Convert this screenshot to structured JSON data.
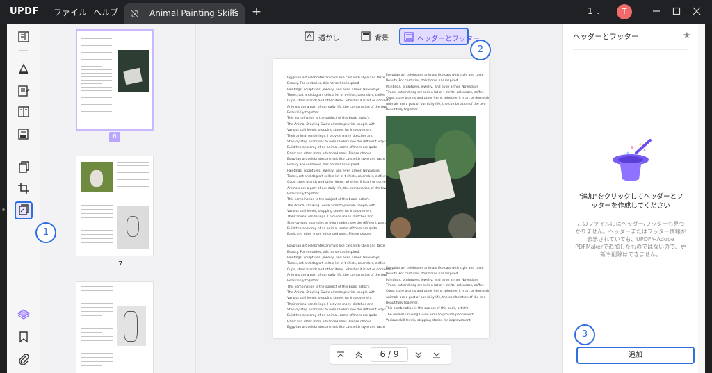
{
  "titlebar": {
    "logo": "UPDF",
    "menu": [
      "ファイル",
      "ヘルプ"
    ],
    "tab_title": "Animal Painting Skills",
    "page_count": "1",
    "avatar_initial": "T"
  },
  "toolbar": {
    "tabs": [
      {
        "label": "透かし",
        "icon": "watermark-icon"
      },
      {
        "label": "背景",
        "icon": "background-icon"
      },
      {
        "label": "ヘッダーとフッター",
        "icon": "header-footer-icon"
      }
    ],
    "active_tab": "ヘッダーとフッター"
  },
  "thumbnails": {
    "selected_page_badge": "6",
    "pages": [
      "7"
    ]
  },
  "document": {
    "left_column": [
      "Egyptian art celebrates animals like cats with style and taste",
      "Beauty. For centuries, this horse has inspired",
      "Paintings, sculptures, jewelry, and even armor. Nowadays",
      "Times, cat and dog art sells a lot of t-shirts, calendars, coffee",
      "Cups, store brands and other items. whether it is art or domestic",
      "Animals are a part of our daily life, the combination of the two",
      "Beautifully together.",
      "This combination is the subject of this book, artist's",
      "The Animal Drawing Guide aims to provide people with",
      "Various skill levels, stepping stones for improvement",
      "Their animal renderings. I provide many sketches and",
      "Step-by-step examples to help readers see the different ways",
      "Build the anatomy of an animal. some of them are quite",
      "Basic and other more advanced ones. Please choose",
      "Egyptian art celebrates animals like cats with style and taste",
      "Beauty. For centuries, this horse has inspired",
      "Paintings, sculptures, jewelry, and even armor. Nowadays",
      "Times, cat and dog art sells a lot of t-shirts, calendars, coffee",
      "Cups, store brands and other items. whether it is art or domestic",
      "Animals are a part of our daily life, the combination of the two",
      "Beautifully together.",
      "This combination is the subject of this book, artist's",
      "The Animal Drawing Guide aims to provide people with",
      "Various skill levels, stepping stones for improvement",
      "Their animal renderings. I provide many sketches and",
      "Step-by-step examples to help readers see the different ways",
      "Build the anatomy of an animal. some of them are quite",
      "Basic and other more advanced ones. Please choose",
      "",
      "Egyptian art celebrates animals like cats with style and taste",
      "Beauty. For centuries, this horse has inspired",
      "Paintings, sculptures, jewelry, and even armor. Nowadays",
      "Times, cat and dog art sells a lot of t-shirts, calendars, coffee",
      "Cups, store brands and other items. whether it is art or domestic",
      "Animals are a part of our daily life, the combination of the two",
      "Beautifully together.",
      "This combination is the subject of this book, artist's",
      "The Animal Drawing Guide aims to provide people with",
      "Various skill levels, stepping stones for improvement",
      "Their animal renderings. I provide many sketches and",
      "Step-by-step examples to help readers see the different ways",
      "Build the anatomy of an animal. some of them are quite",
      "Basic and other more advanced ones. Please choose",
      "Egyptian art celebrates animals like cats with style and taste"
    ],
    "right_top": [
      "Egyptian art celebrates animals like cats with style and taste",
      "Beauty. For centuries, this horse has inspired",
      "Paintings, sculptures, jewelry, and even armor. Nowadays",
      "Times, cat and dog art sells a lot of t-shirts, calendars, coffee",
      "Cups, store brands and other items. whether it is art or domestic",
      "Animals are a part of our daily life, the combination of the two",
      "Beautifully together."
    ],
    "right_bottom": [
      "Egyptian art celebrates animals like cats with style and taste",
      "Beauty. For centuries, this horse has inspired",
      "Paintings, sculptures, jewelry, and even armor. Nowadays",
      "Times, cat and dog art sells a lot of t-shirts, calendars, coffee",
      "Cups, store brands and other items. whether it is art or domestic",
      "Animals are a part of our daily life, the combination of the two",
      "Beautifully together.",
      "This combination is the subject of this book, artist's",
      "The Animal Drawing Guide aims to provide people with",
      "Various skill levels, stepping stones for improvement"
    ]
  },
  "pager": {
    "current_page": "6 / 9"
  },
  "right_panel": {
    "title": "ヘッダーとフッター",
    "main_message": "\"追加\"をクリックしてヘッダーとフッターを作成してください",
    "sub_message": "このファイルにはヘッダー/フッターも見つかりません。ヘッダーまたはフッター情報が表示されていても、UPDFやAdobe PDFMakerで追加したものではないので、更新や削除はできません。",
    "add_button": "追加"
  },
  "callouts": [
    "1",
    "2",
    "3"
  ],
  "colors": {
    "accent": "#2f6fe0",
    "brand_purple": "#6a4cf5",
    "titlebar": "#202124"
  }
}
